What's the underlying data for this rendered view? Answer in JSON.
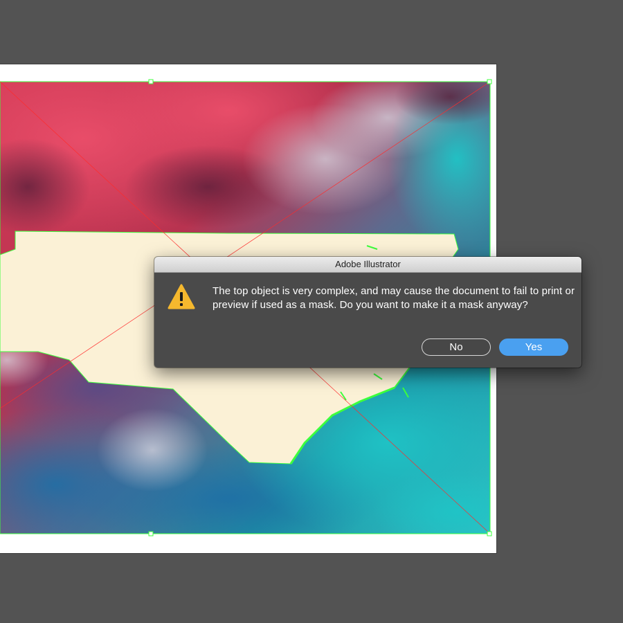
{
  "dialog": {
    "title": "Adobe Illustrator",
    "message": "The top object is very complex, and may cause the document to fail to print or preview if used as a mask.  Do you want to make it a mask anyway?",
    "buttons": {
      "no_label": "No",
      "yes_label": "Yes"
    },
    "icon": "warning-icon"
  },
  "colors": {
    "workspace": "#535353",
    "artboard": "#ffffff",
    "selection": "#3dff3d",
    "shape_fill": "#fbf1d6",
    "default_button": "#4aa0f0",
    "dialog_bg": "#4a4a4a",
    "warning": "#f5b82e"
  }
}
